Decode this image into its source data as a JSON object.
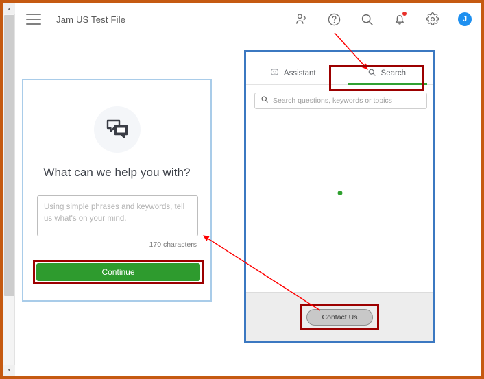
{
  "window": {
    "border_color": "#c55a11",
    "scrollbar": {
      "up_arrow": "▲",
      "down_arrow": "▼"
    }
  },
  "header": {
    "menu_icon": "hamburger-icon",
    "title": "Jam US Test File",
    "icons": [
      {
        "name": "people-icon",
        "label": "People"
      },
      {
        "name": "help-icon",
        "label": "Help"
      },
      {
        "name": "search-icon",
        "label": "Search"
      },
      {
        "name": "notifications-icon",
        "label": "Notifications",
        "badge": true
      },
      {
        "name": "settings-gear-icon",
        "label": "Settings"
      }
    ],
    "avatar_initial": "J",
    "avatar_color": "#1e90f0"
  },
  "help_card": {
    "border_color": "#a9cce9",
    "icon_name": "chat-bubbles-icon",
    "title": "What can we help you with?",
    "textarea": {
      "value": "",
      "placeholder": "Using simple phrases and keywords, tell us what's on your mind."
    },
    "char_count": "170 characters",
    "continue_label": "Continue",
    "continue_color": "#2e9b2e"
  },
  "widget": {
    "border_color": "#3b78c1",
    "tabs": [
      {
        "label": "Assistant",
        "icon": "assistant-chat-icon",
        "active": false
      },
      {
        "label": "Search",
        "icon": "search-icon",
        "active": true
      }
    ],
    "active_tab_underline_color": "#31a031",
    "search": {
      "value": "",
      "placeholder": "Search questions, keywords or topics",
      "icon": "search-icon"
    },
    "loading_indicator": {
      "name": "loading-dot",
      "color": "#2fa02f"
    },
    "footer": {
      "contact_label": "Contact Us"
    }
  },
  "annotations": {
    "highlight_color": "#9c0000",
    "arrow_color": "#ff0000",
    "items": [
      {
        "name": "arrow-help-to-search-tab",
        "from": "help-icon",
        "to": "search-tab"
      },
      {
        "name": "arrow-contact-to-textarea",
        "from": "contact-us-button",
        "to": "help-textarea"
      },
      {
        "name": "box-search-tab",
        "target": "search-tab"
      },
      {
        "name": "box-continue-button",
        "target": "continue-button"
      },
      {
        "name": "box-contact-us",
        "target": "contact-us-button"
      }
    ]
  }
}
